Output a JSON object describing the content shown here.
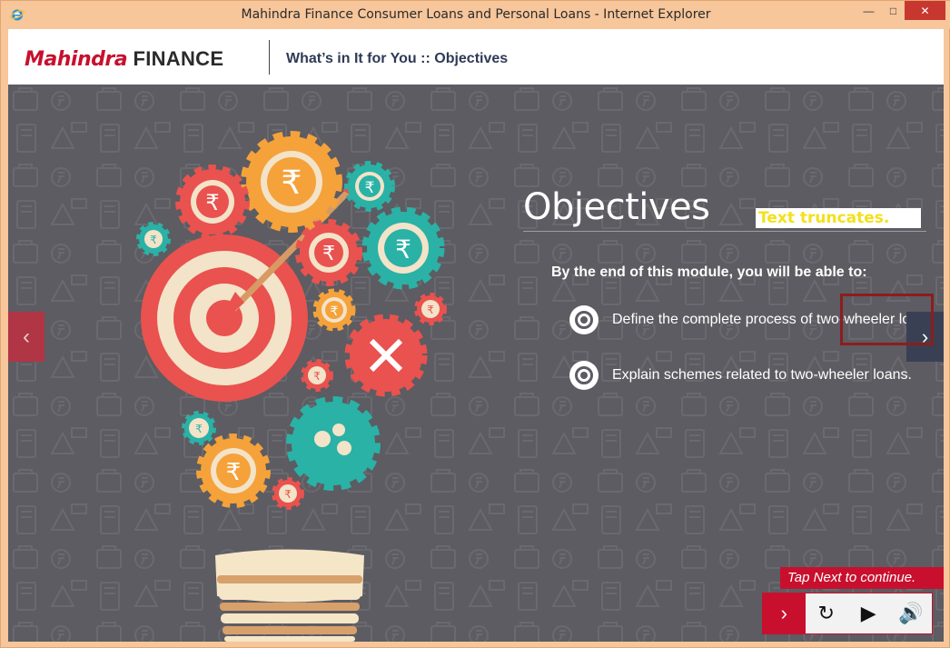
{
  "window": {
    "title": "Mahindra Finance Consumer Loans and Personal Loans - Internet Explorer",
    "app_icon": "internet-explorer-icon",
    "minimize": "—",
    "maximize": "□",
    "close": "✕"
  },
  "header": {
    "logo_brand": "Mahindra",
    "logo_finance": "FINANCE",
    "page_heading": "What’s in It for You :: Objectives"
  },
  "content": {
    "title": "Objectives",
    "annotation": "Text truncates.",
    "lead": "By the end of this module, you will be able to:",
    "bullets": [
      "Define the complete process of two-wheeler loans.",
      "Explain schemes related to two-wheeler loans."
    ]
  },
  "nav": {
    "prev_glyph": "‹",
    "next_glyph": "›",
    "tap_next": "Tap Next to continue."
  },
  "controls": {
    "next": "›",
    "replay": "↻",
    "play": "▶",
    "audio": "🔊"
  },
  "colors": {
    "brand_red": "#c8102e",
    "stage_bg": "#5c5c62",
    "teal": "#2ab2a6",
    "orange": "#f5a23b",
    "coral": "#e9524e"
  }
}
